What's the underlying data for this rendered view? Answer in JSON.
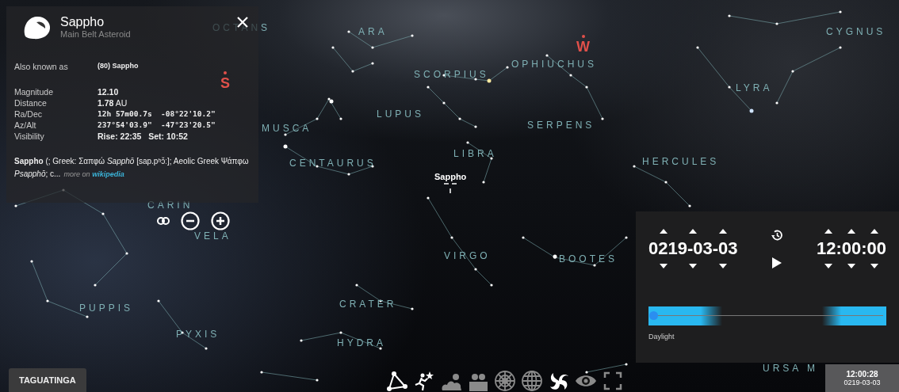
{
  "sky": {
    "labels": [
      {
        "text": "OCTANS"
      },
      {
        "text": "ARA"
      },
      {
        "text": "CYGNUS"
      },
      {
        "text": "OPHIUCHUS"
      },
      {
        "text": "SCORPIUS"
      },
      {
        "text": "LYRA"
      },
      {
        "text": "LUPUS"
      },
      {
        "text": "SERPENS"
      },
      {
        "text": "MUSCA"
      },
      {
        "text": "LIBRA"
      },
      {
        "text": "CENTAURUS"
      },
      {
        "text": "HERCULES"
      },
      {
        "text": "CARIN"
      },
      {
        "text": "VELA"
      },
      {
        "text": "VIRGO"
      },
      {
        "text": "BOOTES"
      },
      {
        "text": "PUPPIS"
      },
      {
        "text": "CRATER"
      },
      {
        "text": "PYXIS"
      },
      {
        "text": "HYDRA"
      },
      {
        "text": "URSA M"
      }
    ],
    "cardinals": [
      {
        "text": "W"
      },
      {
        "text": "S"
      }
    ],
    "target": {
      "label": "Sappho"
    }
  },
  "info": {
    "title": "Sappho",
    "subtitle": "Main Belt Asteroid",
    "rows": [
      {
        "label": "Also known as",
        "value": "**(80) Sappho**",
        "kind": "alias"
      },
      {
        "label": "Magnitude",
        "value": "**12.10**",
        "kind": "text"
      },
      {
        "label": "Distance",
        "value": "**1.78** AU",
        "kind": "text"
      },
      {
        "label": "Ra/Dec",
        "value": "12h 57m00.7s  -08°22'10.2\"",
        "kind": "mono"
      },
      {
        "label": "Az/Alt",
        "value": "237°54'03.9\"  -47°23'20.5\"",
        "kind": "mono"
      },
      {
        "label": "Visibility",
        "value": "**Rise: 22:35   Set: 10:52**",
        "kind": "text"
      }
    ],
    "description": "**Sappho** (; Greek: Σαπφώ *Sapphō* [sap.pʰɔ̌ː]; Aeolic Greek Ψάπφω *Psapphō*; c...",
    "more": "more on",
    "link": "wikipedia"
  },
  "time_panel": {
    "date": "0219-03-03",
    "time": "12:00:00",
    "slider": {
      "level": 0.02,
      "label": "Daylight"
    }
  },
  "location": "TAGUATINGA",
  "toolbar": [
    {
      "kind": "lines",
      "on": true
    },
    {
      "kind": "art",
      "on": true
    },
    {
      "kind": "atmosphere",
      "on": false
    },
    {
      "kind": "landscape",
      "on": false
    },
    {
      "kind": "azgrid",
      "on": false
    },
    {
      "kind": "eqgrid",
      "on": false
    },
    {
      "kind": "dso",
      "on": true
    },
    {
      "kind": "night",
      "on": false
    },
    {
      "kind": "fullscreen",
      "on": false
    }
  ],
  "clock": {
    "time": "12:00:28",
    "date": "0219-03-03"
  }
}
